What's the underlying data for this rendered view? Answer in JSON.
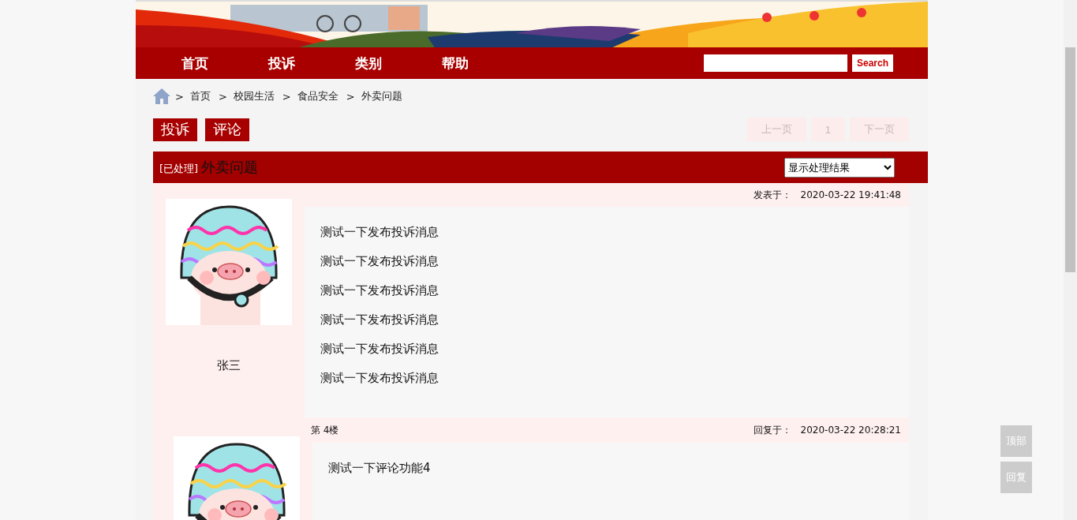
{
  "nav": {
    "items": [
      {
        "label": "首页"
      },
      {
        "label": "投诉"
      },
      {
        "label": "类别"
      },
      {
        "label": "帮助"
      }
    ],
    "search_button": "Search"
  },
  "breadcrumb": {
    "separator": ">",
    "items": [
      "首页",
      "校园生活",
      "食品安全",
      "外卖问题"
    ]
  },
  "actions": [
    "投诉",
    "评论"
  ],
  "pagination": [
    {
      "label": "上一页",
      "disabled": true
    },
    {
      "label": "1",
      "disabled": true
    },
    {
      "label": "下一页",
      "disabled": true
    }
  ],
  "topic": {
    "status": "[已处理]",
    "title": "外卖问题",
    "filter": "显示处理结果"
  },
  "post": {
    "date_label": "发表于：",
    "date": "2020-03-22 19:41:48",
    "author": "张三",
    "paragraphs": [
      "测试一下发布投诉消息",
      "测试一下发布投诉消息",
      "测试一下发布投诉消息",
      "测试一下发布投诉消息",
      "测试一下发布投诉消息",
      "测试一下发布投诉消息"
    ]
  },
  "reply": {
    "floor": "第 4楼",
    "date_label": "回复于：",
    "date": "2020-03-22 20:28:21",
    "content": "测试一下评论功能4"
  },
  "float_buttons": [
    "顶部",
    "回复"
  ]
}
